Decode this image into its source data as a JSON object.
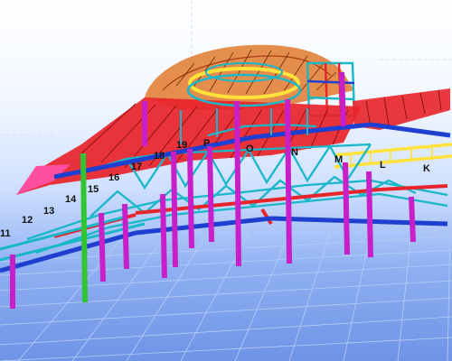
{
  "viewport": {
    "background_top": "#ffffff",
    "background_bottom": "#6f93e6",
    "grid_line_color": "#b9cdf6",
    "construction_line_color": "#cfd8ee"
  },
  "colors": {
    "roof_red": "#e8232a",
    "beam_blue": "#1f3fd0",
    "brace_cyan": "#19b7c8",
    "column_magenta": "#c81fc8",
    "highlight_green": "#33c433",
    "ring_yellow": "#ffe23a",
    "cladding_orange": "#e07a2e",
    "edge_pink": "#ff4fa0"
  },
  "grid_labels": {
    "col_11": "11",
    "col_12": "12",
    "col_13": "13",
    "col_14": "14",
    "col_15": "15",
    "col_16": "16",
    "col_17": "17",
    "col_18": "18",
    "col_19": "19",
    "row_P": "P",
    "row_O": "O",
    "row_N": "N",
    "row_M": "M",
    "row_L": "L",
    "row_K": "K"
  }
}
